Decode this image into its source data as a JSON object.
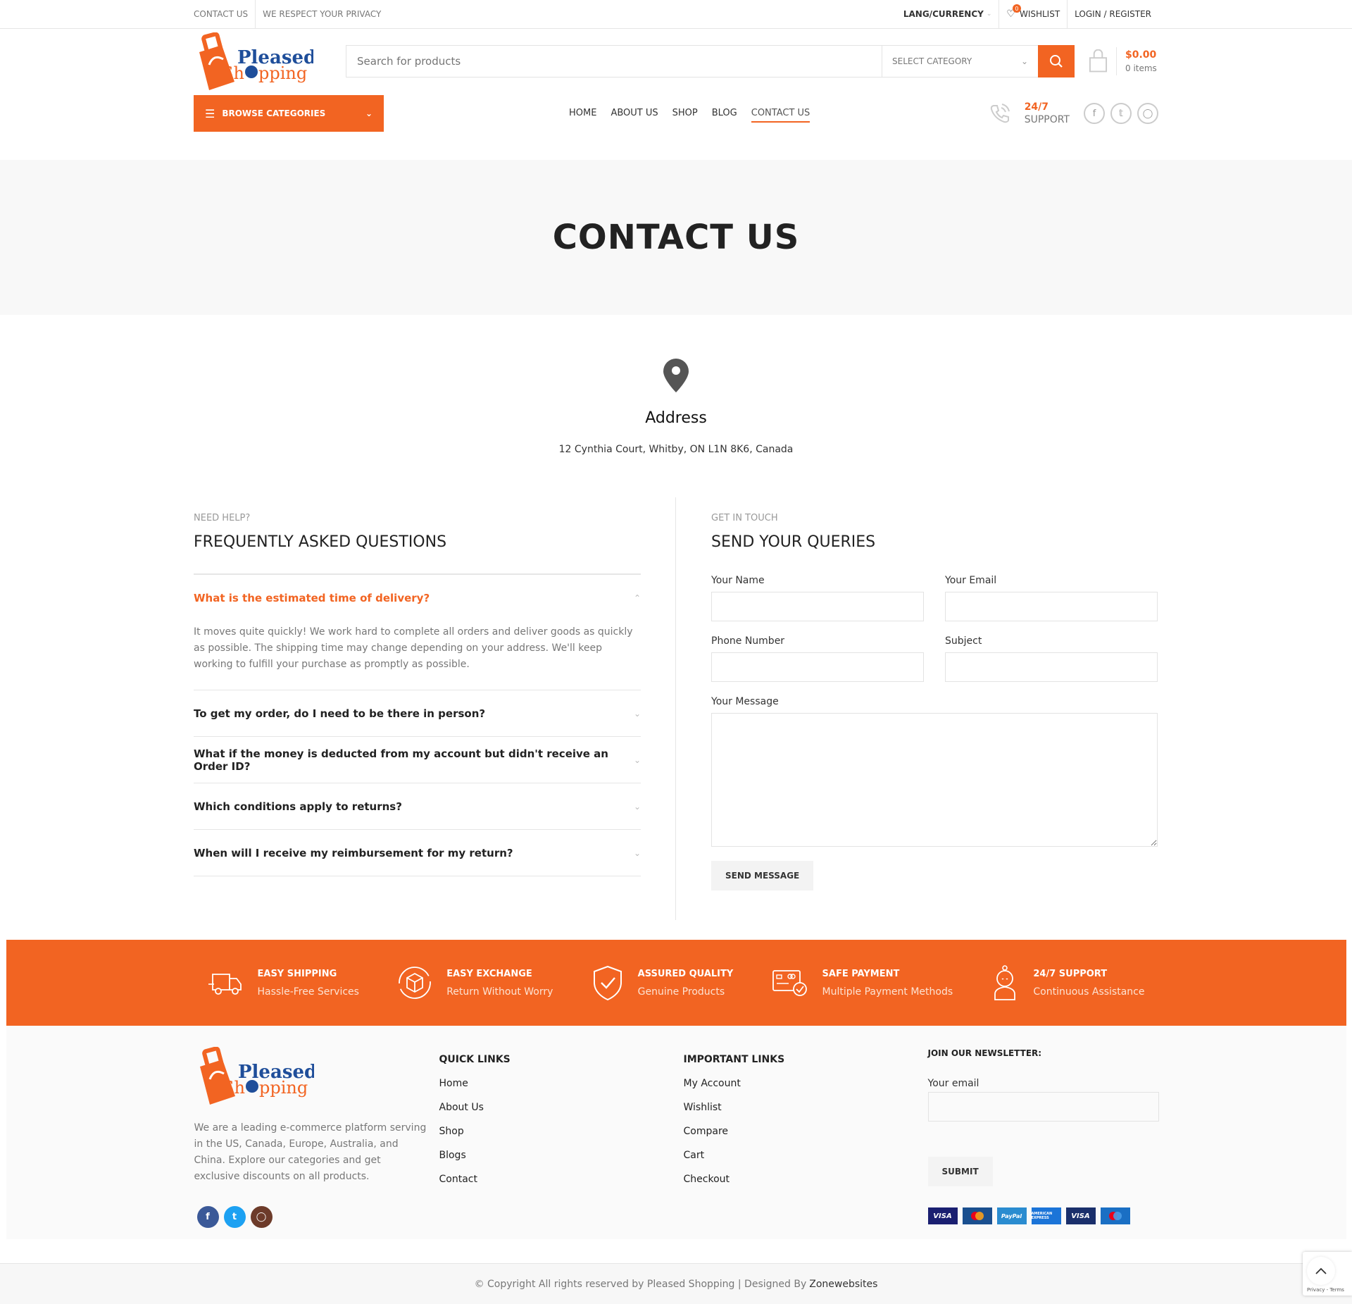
{
  "topbar": {
    "contact_us": "CONTACT US",
    "privacy": "WE RESPECT YOUR PRIVACY",
    "lang_currency": "LANG/CURRENCY",
    "wishlist_count": "0",
    "wishlist": "WISHLIST",
    "login_register": "LOGIN / REGISTER"
  },
  "brand": {
    "name_line1": "Pleased",
    "name_line2_a": "Sh",
    "name_line2_b": "pping",
    "accent_color": "#f26422",
    "blue_color": "#1f4e9a"
  },
  "search": {
    "placeholder": "Search for products",
    "category_label": "SELECT CATEGORY"
  },
  "cart": {
    "total": "$0.00",
    "items": "0 items"
  },
  "nav": {
    "browse_label": "BROWSE CATEGORIES",
    "items": [
      "HOME",
      "ABOUT US",
      "SHOP",
      "BLOG",
      "CONTACT US"
    ],
    "active": "CONTACT US",
    "support_line1": "24/7",
    "support_line2": "SUPPORT"
  },
  "page": {
    "title": "CONTACT US"
  },
  "address": {
    "heading": "Address",
    "value": "12 Cynthia Court, Whitby, ON L1N 8K6, Canada"
  },
  "faq": {
    "subtitle": "NEED HELP?",
    "title": "FREQUENTLY ASKED QUESTIONS",
    "open_question": "What is the estimated time of delivery?",
    "open_answer": "It moves quite quickly! We work hard to complete all orders and deliver goods as quickly as possible. The shipping time may change depending on your address. We'll keep working to fulfill your purchase as promptly as possible.",
    "questions": [
      "To get my order, do I need to be there in person?",
      "What if the money is deducted from my account but didn't receive an Order ID?",
      "Which conditions apply to returns?",
      "When will I receive my reimbursement for my return?"
    ]
  },
  "form": {
    "subtitle": "GET IN TOUCH",
    "title": "SEND YOUR QUERIES",
    "name_label": "Your Name",
    "email_label": "Your Email",
    "phone_label": "Phone Number",
    "subject_label": "Subject",
    "message_label": "Your Message",
    "submit": "SEND MESSAGE"
  },
  "features": [
    {
      "title": "EASY SHIPPING",
      "subtitle": "Hassle-Free Services",
      "icon": "truck-icon"
    },
    {
      "title": "EASY EXCHANGE",
      "subtitle": "Return Without Worry",
      "icon": "box-exchange-icon"
    },
    {
      "title": "ASSURED QUALITY",
      "subtitle": "Genuine Products",
      "icon": "shield-check-icon"
    },
    {
      "title": "SAFE PAYMENT",
      "subtitle": "Multiple Payment Methods",
      "icon": "card-check-icon"
    },
    {
      "title": "24/7 SUPPORT",
      "subtitle": "Continuous Assistance",
      "icon": "support-agent-icon"
    }
  ],
  "footer": {
    "about": "We are a leading e-commerce platform serving in the US, Canada, Europe, Australia, and China. Explore our categories and get exclusive discounts on all products.",
    "quick_links_title": "QUICK LINKS",
    "quick_links": [
      "Home",
      "About Us",
      "Shop",
      "Blogs",
      "Contact"
    ],
    "important_links_title": "IMPORTANT LINKS",
    "important_links": [
      "My Account",
      "Wishlist",
      "Compare",
      "Cart",
      "Checkout"
    ],
    "newsletter_title": "JOIN OUR NEWSLETTER:",
    "newsletter_label": "Your email",
    "newsletter_submit": "SUBMIT",
    "payment_methods": [
      "VISA",
      "Mastercard",
      "PayPal",
      "American Express",
      "VISA Electron",
      "Maestro"
    ],
    "copyright": "© Copyright All rights reserved by Pleased Shopping | Designed By",
    "designer": "Zonewebsites",
    "recaptcha": "Privacy - Terms"
  }
}
